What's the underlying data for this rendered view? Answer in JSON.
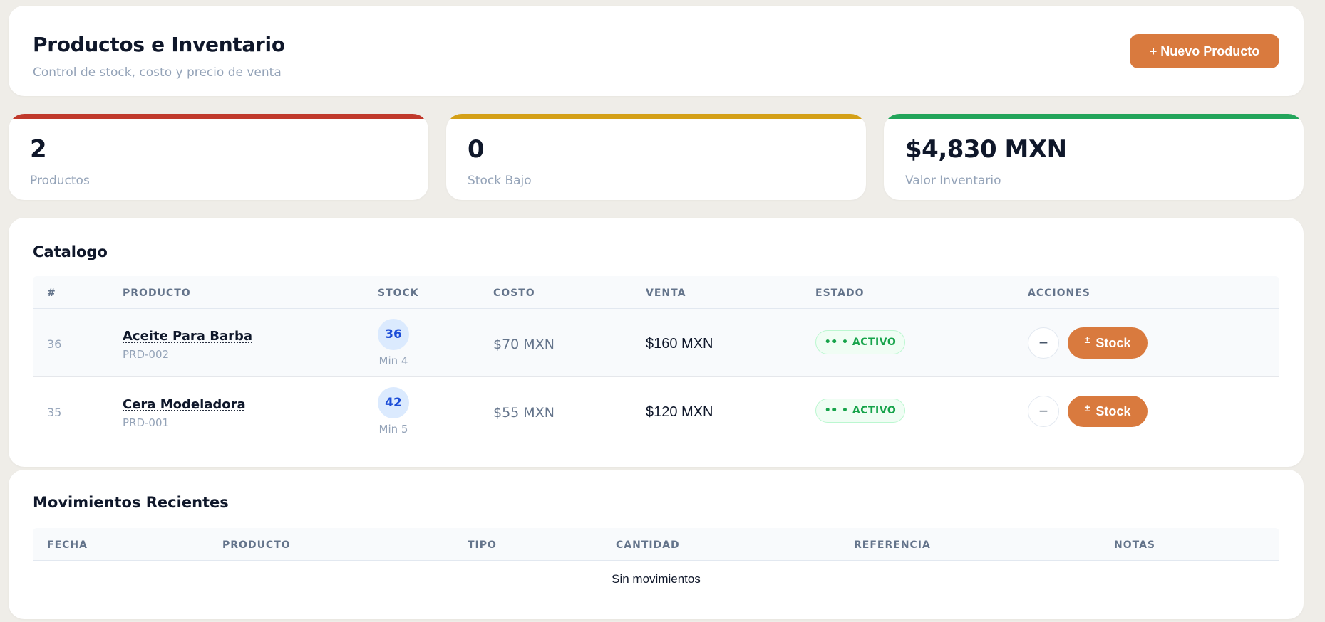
{
  "header": {
    "title": "Productos e Inventario",
    "subtitle": "Control de stock, costo y precio de venta",
    "new_button": "+ Nuevo Producto"
  },
  "colors": {
    "accent": "#d97a3e",
    "danger": "#c0392b",
    "warning": "#d4a017",
    "success": "#22a55a"
  },
  "stats": [
    {
      "value": "2",
      "label": "Productos",
      "color": "#c0392b"
    },
    {
      "value": "0",
      "label": "Stock Bajo",
      "color": "#d4a017"
    },
    {
      "value": "$4,830 MXN",
      "label": "Valor Inventario",
      "color": "#22a55a"
    }
  ],
  "catalog": {
    "title": "Catalogo",
    "columns": [
      "#",
      "PRODUCTO",
      "STOCK",
      "COSTO",
      "VENTA",
      "ESTADO",
      "ACCIONES"
    ],
    "rows": [
      {
        "id": "36",
        "name": "Aceite Para Barba",
        "sku": "PRD-002",
        "stock": "36",
        "min": "Min 4",
        "cost": "$70 MXN",
        "sale": "$160 MXN",
        "status": "•• • ACTIVO",
        "minus": "−",
        "stock_icon": "±",
        "stock_label": "Stock"
      },
      {
        "id": "35",
        "name": "Cera Modeladora",
        "sku": "PRD-001",
        "stock": "42",
        "min": "Min 5",
        "cost": "$55 MXN",
        "sale": "$120 MXN",
        "status": "•• • ACTIVO",
        "minus": "−",
        "stock_icon": "±",
        "stock_label": "Stock"
      }
    ]
  },
  "movements": {
    "title": "Movimientos Recientes",
    "columns": [
      "FECHA",
      "PRODUCTO",
      "TIPO",
      "CANTIDAD",
      "REFERENCIA",
      "NOTAS"
    ],
    "empty": "Sin movimientos"
  }
}
